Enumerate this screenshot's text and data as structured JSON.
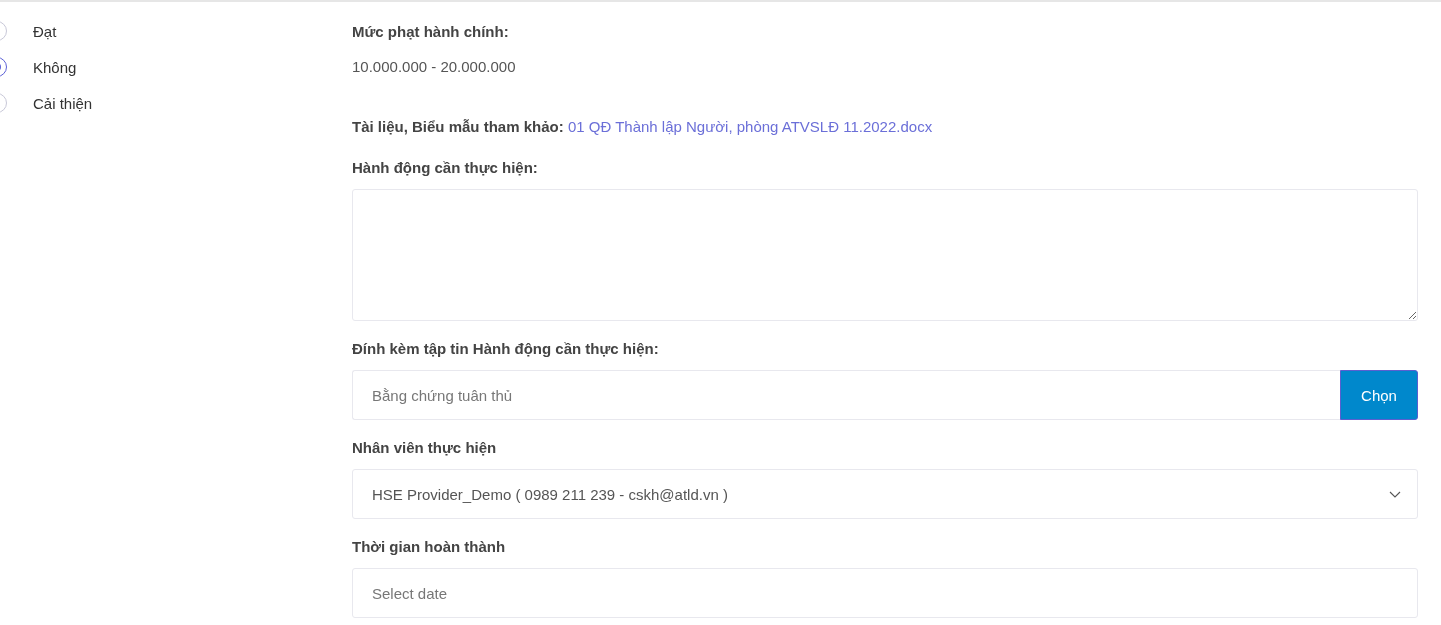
{
  "options": [
    {
      "label": "Đạt",
      "selected": false
    },
    {
      "label": "Không",
      "selected": true
    },
    {
      "label": "Cải thiện",
      "selected": false
    }
  ],
  "penalty": {
    "label": "Mức phạt hành chính:",
    "value": "10.000.000 - 20.000.000"
  },
  "reference": {
    "label": "Tài liệu, Biểu mẫu tham khảo:",
    "link": "01 QĐ Thành lập Người, phòng ATVSLĐ 11.2022.docx"
  },
  "action": {
    "label": "Hành động cần thực hiện:"
  },
  "attachment": {
    "label": "Đính kèm tập tin Hành động cần thực hiện:",
    "placeholder": "Bằng chứng tuân thủ",
    "button": "Chọn"
  },
  "staff": {
    "label": "Nhân viên thực hiện",
    "value": "HSE Provider_Demo ( 0989 211 239 - cskh@atld.vn )"
  },
  "due": {
    "label": "Thời gian hoàn thành",
    "placeholder": "Select date"
  }
}
